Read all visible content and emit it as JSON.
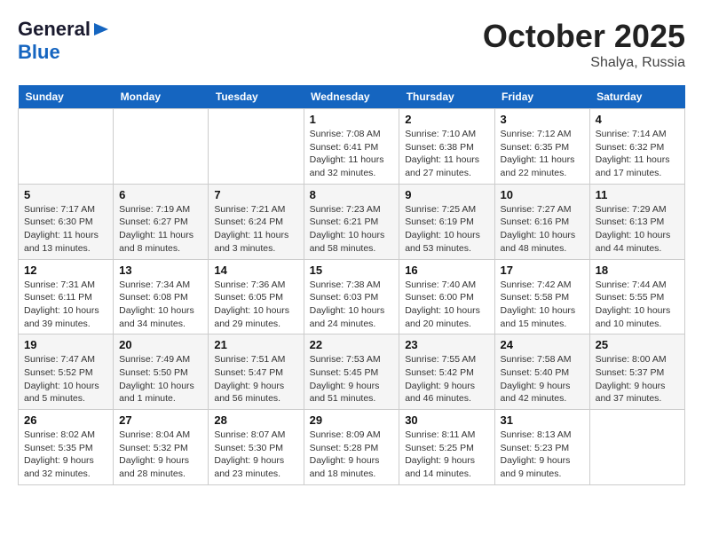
{
  "logo": {
    "line1": "General",
    "line2": "Blue",
    "arrow": "▶"
  },
  "title": "October 2025",
  "location": "Shalya, Russia",
  "days_header": [
    "Sunday",
    "Monday",
    "Tuesday",
    "Wednesday",
    "Thursday",
    "Friday",
    "Saturday"
  ],
  "weeks": [
    [
      {
        "day": "",
        "info": ""
      },
      {
        "day": "",
        "info": ""
      },
      {
        "day": "",
        "info": ""
      },
      {
        "day": "1",
        "info": "Sunrise: 7:08 AM\nSunset: 6:41 PM\nDaylight: 11 hours\nand 32 minutes."
      },
      {
        "day": "2",
        "info": "Sunrise: 7:10 AM\nSunset: 6:38 PM\nDaylight: 11 hours\nand 27 minutes."
      },
      {
        "day": "3",
        "info": "Sunrise: 7:12 AM\nSunset: 6:35 PM\nDaylight: 11 hours\nand 22 minutes."
      },
      {
        "day": "4",
        "info": "Sunrise: 7:14 AM\nSunset: 6:32 PM\nDaylight: 11 hours\nand 17 minutes."
      }
    ],
    [
      {
        "day": "5",
        "info": "Sunrise: 7:17 AM\nSunset: 6:30 PM\nDaylight: 11 hours\nand 13 minutes."
      },
      {
        "day": "6",
        "info": "Sunrise: 7:19 AM\nSunset: 6:27 PM\nDaylight: 11 hours\nand 8 minutes."
      },
      {
        "day": "7",
        "info": "Sunrise: 7:21 AM\nSunset: 6:24 PM\nDaylight: 11 hours\nand 3 minutes."
      },
      {
        "day": "8",
        "info": "Sunrise: 7:23 AM\nSunset: 6:21 PM\nDaylight: 10 hours\nand 58 minutes."
      },
      {
        "day": "9",
        "info": "Sunrise: 7:25 AM\nSunset: 6:19 PM\nDaylight: 10 hours\nand 53 minutes."
      },
      {
        "day": "10",
        "info": "Sunrise: 7:27 AM\nSunset: 6:16 PM\nDaylight: 10 hours\nand 48 minutes."
      },
      {
        "day": "11",
        "info": "Sunrise: 7:29 AM\nSunset: 6:13 PM\nDaylight: 10 hours\nand 44 minutes."
      }
    ],
    [
      {
        "day": "12",
        "info": "Sunrise: 7:31 AM\nSunset: 6:11 PM\nDaylight: 10 hours\nand 39 minutes."
      },
      {
        "day": "13",
        "info": "Sunrise: 7:34 AM\nSunset: 6:08 PM\nDaylight: 10 hours\nand 34 minutes."
      },
      {
        "day": "14",
        "info": "Sunrise: 7:36 AM\nSunset: 6:05 PM\nDaylight: 10 hours\nand 29 minutes."
      },
      {
        "day": "15",
        "info": "Sunrise: 7:38 AM\nSunset: 6:03 PM\nDaylight: 10 hours\nand 24 minutes."
      },
      {
        "day": "16",
        "info": "Sunrise: 7:40 AM\nSunset: 6:00 PM\nDaylight: 10 hours\nand 20 minutes."
      },
      {
        "day": "17",
        "info": "Sunrise: 7:42 AM\nSunset: 5:58 PM\nDaylight: 10 hours\nand 15 minutes."
      },
      {
        "day": "18",
        "info": "Sunrise: 7:44 AM\nSunset: 5:55 PM\nDaylight: 10 hours\nand 10 minutes."
      }
    ],
    [
      {
        "day": "19",
        "info": "Sunrise: 7:47 AM\nSunset: 5:52 PM\nDaylight: 10 hours\nand 5 minutes."
      },
      {
        "day": "20",
        "info": "Sunrise: 7:49 AM\nSunset: 5:50 PM\nDaylight: 10 hours\nand 1 minute."
      },
      {
        "day": "21",
        "info": "Sunrise: 7:51 AM\nSunset: 5:47 PM\nDaylight: 9 hours\nand 56 minutes."
      },
      {
        "day": "22",
        "info": "Sunrise: 7:53 AM\nSunset: 5:45 PM\nDaylight: 9 hours\nand 51 minutes."
      },
      {
        "day": "23",
        "info": "Sunrise: 7:55 AM\nSunset: 5:42 PM\nDaylight: 9 hours\nand 46 minutes."
      },
      {
        "day": "24",
        "info": "Sunrise: 7:58 AM\nSunset: 5:40 PM\nDaylight: 9 hours\nand 42 minutes."
      },
      {
        "day": "25",
        "info": "Sunrise: 8:00 AM\nSunset: 5:37 PM\nDaylight: 9 hours\nand 37 minutes."
      }
    ],
    [
      {
        "day": "26",
        "info": "Sunrise: 8:02 AM\nSunset: 5:35 PM\nDaylight: 9 hours\nand 32 minutes."
      },
      {
        "day": "27",
        "info": "Sunrise: 8:04 AM\nSunset: 5:32 PM\nDaylight: 9 hours\nand 28 minutes."
      },
      {
        "day": "28",
        "info": "Sunrise: 8:07 AM\nSunset: 5:30 PM\nDaylight: 9 hours\nand 23 minutes."
      },
      {
        "day": "29",
        "info": "Sunrise: 8:09 AM\nSunset: 5:28 PM\nDaylight: 9 hours\nand 18 minutes."
      },
      {
        "day": "30",
        "info": "Sunrise: 8:11 AM\nSunset: 5:25 PM\nDaylight: 9 hours\nand 14 minutes."
      },
      {
        "day": "31",
        "info": "Sunrise: 8:13 AM\nSunset: 5:23 PM\nDaylight: 9 hours\nand 9 minutes."
      },
      {
        "day": "",
        "info": ""
      }
    ]
  ]
}
